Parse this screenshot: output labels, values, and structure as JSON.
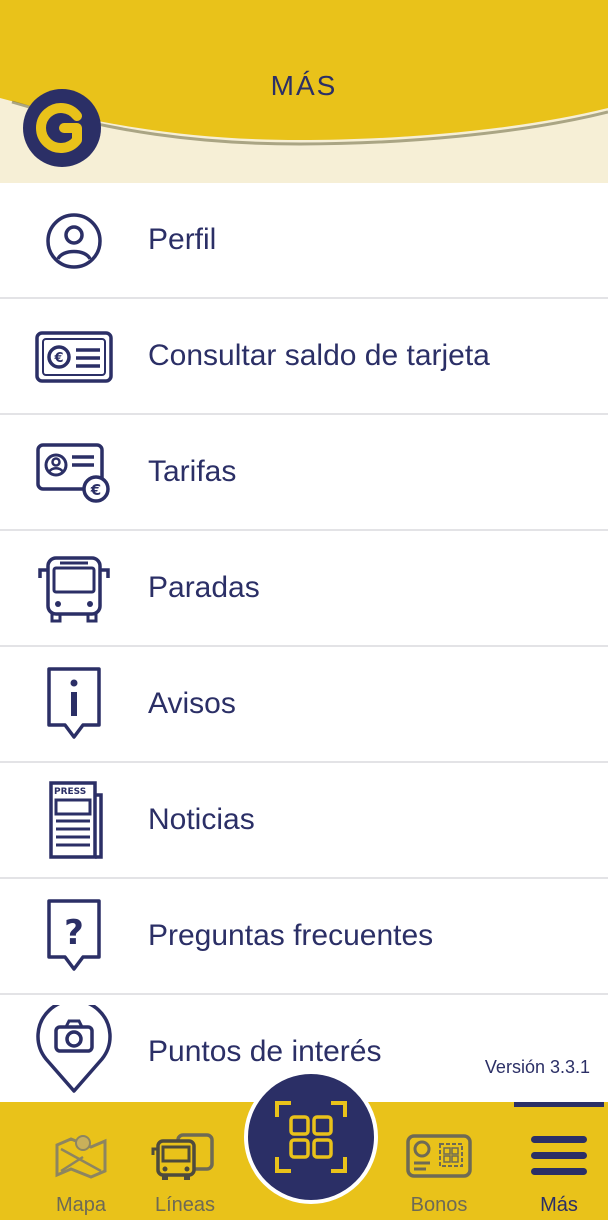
{
  "header": {
    "title": "MÁS"
  },
  "menu": {
    "items": [
      {
        "label": "Perfil",
        "icon": "user-profile-icon"
      },
      {
        "label": "Consultar saldo de tarjeta",
        "icon": "euro-card-icon"
      },
      {
        "label": "Tarifas",
        "icon": "fare-card-icon"
      },
      {
        "label": "Paradas",
        "icon": "bus-icon"
      },
      {
        "label": "Avisos",
        "icon": "info-alert-icon"
      },
      {
        "label": "Noticias",
        "icon": "newspaper-icon"
      },
      {
        "label": "Preguntas frecuentes",
        "icon": "question-icon"
      },
      {
        "label": "Puntos de interés",
        "icon": "camera-pin-icon"
      }
    ]
  },
  "version": "Versión 3.3.1",
  "nav": {
    "items": [
      {
        "label": "Mapa",
        "icon": "map-icon"
      },
      {
        "label": "Líneas",
        "icon": "buses-icon"
      },
      {
        "label": "",
        "icon": "qr-scan-icon"
      },
      {
        "label": "Bonos",
        "icon": "pass-card-icon"
      },
      {
        "label": "Más",
        "icon": "hamburger-menu-icon"
      }
    ]
  },
  "colors": {
    "primary": "#2b2f66",
    "accent": "#e9c21a",
    "header_bg": "#f6efd6",
    "divider": "#e3e3e6"
  }
}
